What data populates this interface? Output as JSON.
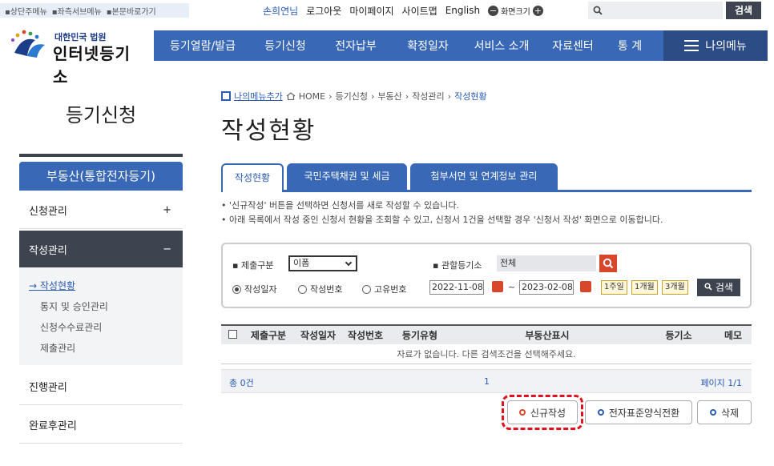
{
  "skip_links": [
    "▪상단주메뉴",
    "▪좌측서브메뉴",
    "▪본문바로가기"
  ],
  "util": {
    "user": "손희연님",
    "logout": "로그아웃",
    "mypage": "마이페이지",
    "sitemap": "사이트맵",
    "english": "English",
    "font_minus": "−",
    "font_label": "화면크기",
    "font_plus": "+",
    "search_placeholder": "",
    "search_button": "검색"
  },
  "logo": {
    "sup": "대한민국 법원",
    "main": "인터넷등기소"
  },
  "nav": {
    "items": [
      "등기열람/발급",
      "등기신청",
      "전자납부",
      "확정일자",
      "서비스 소개",
      "자료센터",
      "통 계"
    ],
    "mymenu": "나의메뉴"
  },
  "sidebar": {
    "title": "등기신청",
    "category": "부동산(통합전자등기)",
    "rows": [
      {
        "label": "신청관리",
        "sign": "+"
      },
      {
        "label": "작성관리",
        "sign": "−"
      },
      {
        "label": "진행관리",
        "sign": ""
      },
      {
        "label": "완료후관리",
        "sign": ""
      }
    ],
    "sub_items": [
      "→ 작성현황",
      "통지 및 승인관리",
      "신청수수료관리",
      "제출관리"
    ]
  },
  "breadcrumb": {
    "add": "나의메뉴추가",
    "path": [
      "HOME",
      "등기신청",
      "부동산",
      "작성관리"
    ],
    "current": "작성현황",
    "sep": "›"
  },
  "page_title": "작성현황",
  "tabs": [
    "작성현황",
    "국민주택채권 및 세금",
    "첨부서면 및 연계정보 관리"
  ],
  "notes": [
    "• '신규작성' 버튼을 선택하면 신청서를 새로 작성할 수 있습니다.",
    "• 아래 목록에서 작성 중인 신청서 현황을 조회할 수 있고, 신청서 1건을 선택할 경우 '신청서 작성' 화면으로 이동합니다."
  ],
  "search": {
    "submit_type_label": "▪ 제출구분",
    "submit_type_value": "이폼",
    "court_label": "▪ 관할등기소",
    "court_value": "전체",
    "radios": [
      "작성일자",
      "작성번호",
      "고유번호"
    ],
    "date_from": "2022-11-08",
    "date_to": "2023-02-08",
    "tilde": "~",
    "ranges": [
      "1주일",
      "1개월",
      "3개월"
    ],
    "find": "검색"
  },
  "table": {
    "headers": [
      "",
      "제출구분",
      "작성일자",
      "작성번호",
      "등기유형",
      "부동산표시",
      "등기소",
      "메모"
    ],
    "empty": "자료가 없습니다. 다른 검색조건을 선택해주세요."
  },
  "pager": {
    "total": "총 0건",
    "num": "1",
    "pages": "페이지 1/1"
  },
  "buttons": {
    "new": "신규작성",
    "convert": "전자표준양식전환",
    "delete": "삭제"
  }
}
